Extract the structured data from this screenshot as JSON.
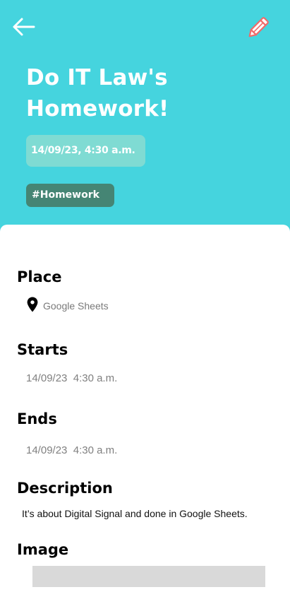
{
  "header": {
    "background_color": "#45d4de",
    "back_icon": "arrow-left-icon",
    "edit_icon": "pencil-icon",
    "edit_icon_color": "#f06a6a",
    "title_line1": "Do IT Law's",
    "title_line2": "Homework!",
    "date_chip": "14/09/23, 4:30 a.m.",
    "tag": "#Homework"
  },
  "details": {
    "place": {
      "heading": "Place",
      "icon": "location-pin-icon",
      "value": "Google Sheets"
    },
    "starts": {
      "heading": "Starts",
      "value": "14/09/23  4:30 a.m."
    },
    "ends": {
      "heading": "Ends",
      "value": "14/09/23  4:30 a.m."
    },
    "description": {
      "heading": "Description",
      "value": "It’s about Digital Signal and done in Google Sheets."
    },
    "image": {
      "heading": "Image"
    }
  }
}
